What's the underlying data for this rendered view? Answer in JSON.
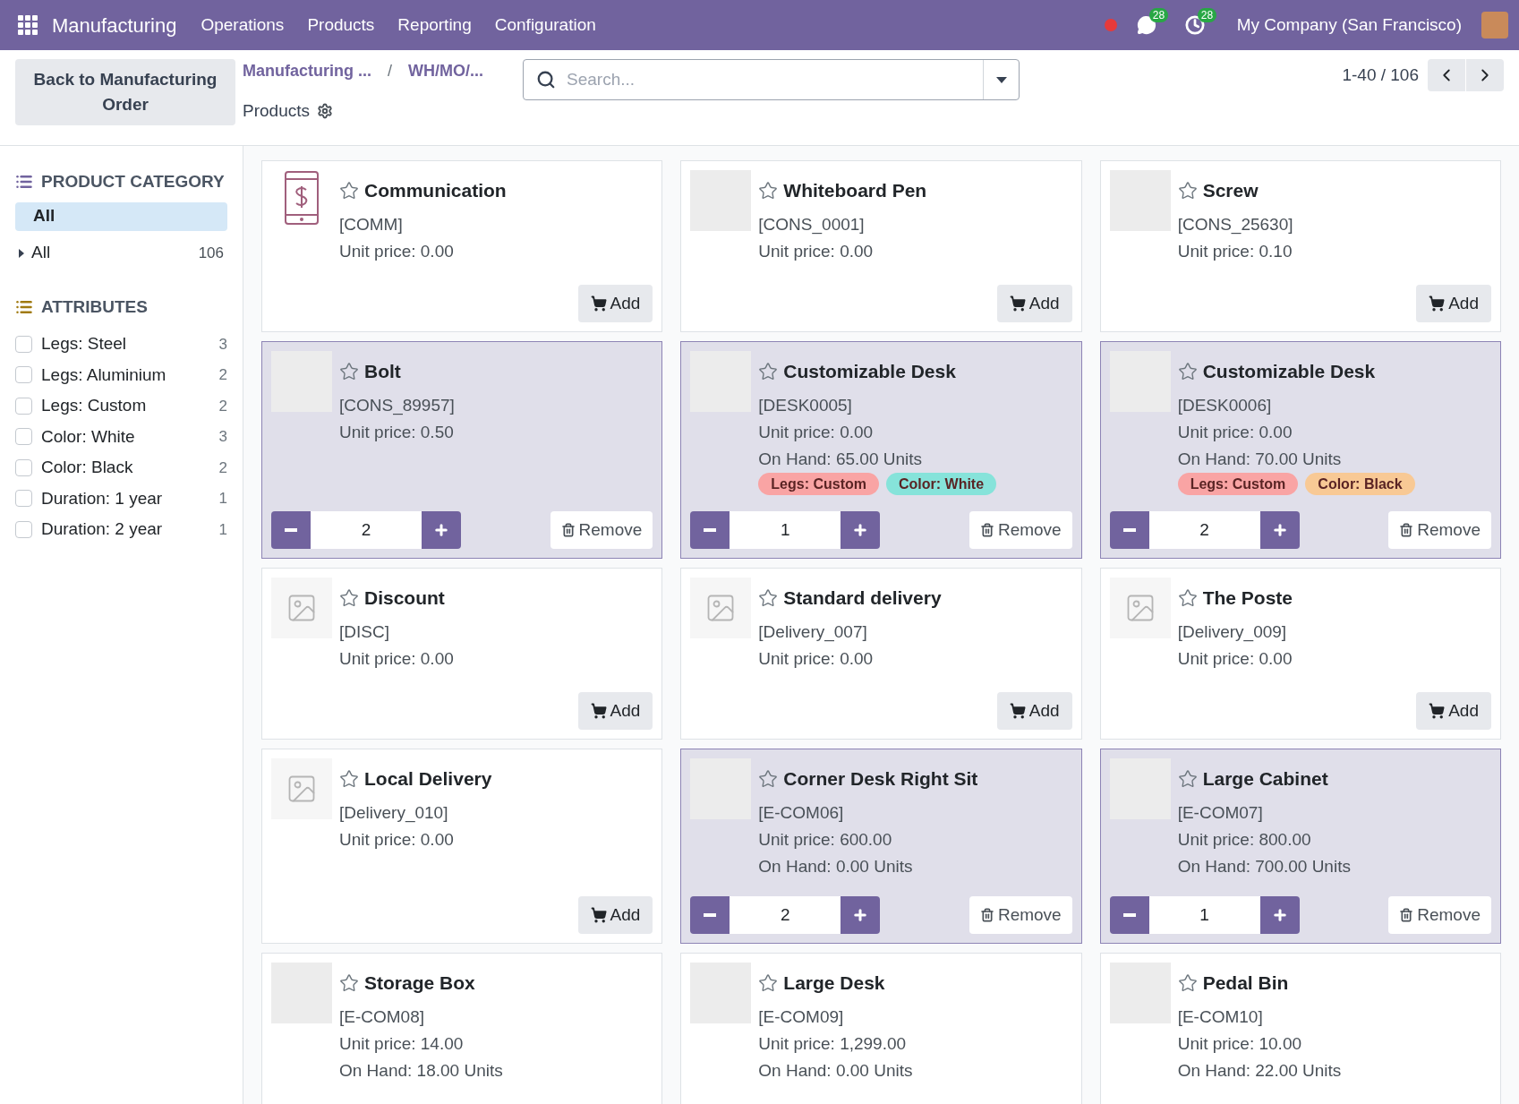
{
  "navbar": {
    "app": "Manufacturing",
    "menu": [
      "Operations",
      "Products",
      "Reporting",
      "Configuration"
    ],
    "messages_badge": "28",
    "activities_badge": "28",
    "company": "My Company (San Francisco)"
  },
  "control_panel": {
    "back_button": "Back to Manufacturing Order",
    "breadcrumbs": [
      "Manufacturing ...",
      "WH/MO/..."
    ],
    "separator": "/",
    "title": "Products",
    "search": {
      "placeholder": "Search..."
    },
    "pager": "1-40 / 106"
  },
  "sidebar": {
    "category_title": "PRODUCT CATEGORY",
    "categories": [
      {
        "label": "All",
        "selected": true,
        "kind": "root"
      },
      {
        "label": "All",
        "count": "106",
        "selected": false,
        "kind": "parent"
      }
    ],
    "attributes_title": "ATTRIBUTES",
    "attributes": [
      {
        "label": "Legs: Steel",
        "count": "3",
        "checked": false
      },
      {
        "label": "Legs: Aluminium",
        "count": "2",
        "checked": false
      },
      {
        "label": "Legs: Custom",
        "count": "2",
        "checked": false
      },
      {
        "label": "Color: White",
        "count": "3",
        "checked": false
      },
      {
        "label": "Color: Black",
        "count": "2",
        "checked": false
      },
      {
        "label": "Duration: 1 year",
        "count": "1",
        "checked": false
      },
      {
        "label": "Duration: 2 year",
        "count": "1",
        "checked": false
      }
    ]
  },
  "products": [
    {
      "name": "Communication",
      "code": "[COMM]",
      "price": "Unit price: 0.00",
      "kind": "phone",
      "selected": false,
      "add": "Add"
    },
    {
      "name": "Whiteboard Pen",
      "code": "[CONS_0001]",
      "price": "Unit price: 0.00",
      "kind": "photo",
      "selected": false,
      "add": "Add"
    },
    {
      "name": "Screw",
      "code": "[CONS_25630]",
      "price": "Unit price: 0.10",
      "kind": "photo",
      "selected": false,
      "add": "Add"
    },
    {
      "name": "Bolt",
      "code": "[CONS_89957]",
      "price": "Unit price: 0.50",
      "kind": "photo",
      "selected": true,
      "quantity": "2",
      "remove": "Remove"
    },
    {
      "name": "Customizable Desk",
      "code": "[DESK0005]",
      "price": "Unit price: 0.00",
      "on_hand": "On Hand: 65.00 Units",
      "tags": [
        {
          "label": "Legs: Custom",
          "color": "#f9a4a4"
        },
        {
          "label": "Color: White",
          "color": "#86e3da"
        }
      ],
      "kind": "photo",
      "selected": true,
      "quantity": "1",
      "remove": "Remove"
    },
    {
      "name": "Customizable Desk",
      "code": "[DESK0006]",
      "price": "Unit price: 0.00",
      "on_hand": "On Hand: 70.00 Units",
      "tags": [
        {
          "label": "Legs: Custom",
          "color": "#f9a4a4"
        },
        {
          "label": "Color: Black",
          "color": "#f8c995"
        }
      ],
      "kind": "photo",
      "selected": true,
      "quantity": "2",
      "remove": "Remove"
    },
    {
      "name": "Discount",
      "code": "[DISC]",
      "price": "Unit price: 0.00",
      "kind": "placeholder",
      "selected": false,
      "add": "Add"
    },
    {
      "name": "Standard delivery",
      "code": "[Delivery_007]",
      "price": "Unit price: 0.00",
      "kind": "placeholder",
      "selected": false,
      "add": "Add"
    },
    {
      "name": "The Poste",
      "code": "[Delivery_009]",
      "price": "Unit price: 0.00",
      "kind": "placeholder",
      "selected": false,
      "add": "Add"
    },
    {
      "name": "Local Delivery",
      "code": "[Delivery_010]",
      "price": "Unit price: 0.00",
      "kind": "placeholder",
      "selected": false,
      "add": "Add"
    },
    {
      "name": "Corner Desk Right Sit",
      "code": "[E-COM06]",
      "price": "Unit price: 600.00",
      "on_hand": "On Hand: 0.00 Units",
      "kind": "photo",
      "selected": true,
      "quantity": "2",
      "remove": "Remove"
    },
    {
      "name": "Large Cabinet",
      "code": "[E-COM07]",
      "price": "Unit price: 800.00",
      "on_hand": "On Hand: 700.00 Units",
      "kind": "photo",
      "selected": true,
      "quantity": "1",
      "remove": "Remove"
    },
    {
      "name": "Storage Box",
      "code": "[E-COM08]",
      "price": "Unit price: 14.00",
      "on_hand": "On Hand: 18.00 Units",
      "kind": "photo",
      "selected": false
    },
    {
      "name": "Large Desk",
      "code": "[E-COM09]",
      "price": "Unit price: 1,299.00",
      "on_hand": "On Hand: 0.00 Units",
      "kind": "photo",
      "selected": false
    },
    {
      "name": "Pedal Bin",
      "code": "[E-COM10]",
      "price": "Unit price: 10.00",
      "on_hand": "On Hand: 22.00 Units",
      "kind": "photo",
      "selected": false
    }
  ]
}
